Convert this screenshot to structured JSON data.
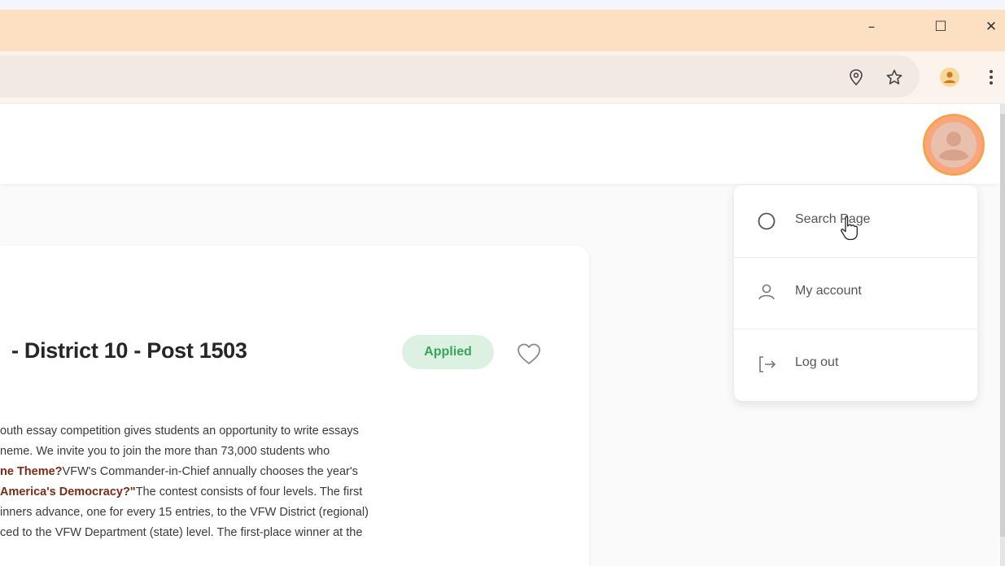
{
  "window": {
    "minimize_label": "–",
    "maximize_label": "☐",
    "close_label": "✕"
  },
  "toolbar": {
    "icons": [
      "location-pin-icon",
      "bookmark-star-icon",
      "profile-icon",
      "kebab-menu-icon"
    ]
  },
  "header": {
    "avatar_icon": "user-avatar-icon"
  },
  "card": {
    "title": "- District 10 - Post 1503",
    "status_badge": "Applied",
    "favorite_icon": "heart-icon",
    "description_lines": [
      {
        "segments": [
          {
            "text": "outh essay competition gives students an opportunity to write essays",
            "bold": false
          }
        ]
      },
      {
        "segments": [
          {
            "text": "neme. We invite you to join the more than 73,000 students who",
            "bold": false
          }
        ]
      },
      {
        "segments": [
          {
            "text": "ne Theme?",
            "bold": true
          },
          {
            "text": "VFW's Commander-in-Chief annually chooses the year's",
            "bold": false
          }
        ]
      },
      {
        "segments": [
          {
            "text": "America's Democracy?\"",
            "bold": true
          },
          {
            "text": "The contest consists of four levels. The first",
            "bold": false
          }
        ]
      },
      {
        "segments": [
          {
            "text": "inners advance, one for every 15 entries, to the VFW District (regional)",
            "bold": false
          }
        ]
      },
      {
        "segments": [
          {
            "text": "ced to the VFW Department (state) level. The first-place winner at the",
            "bold": false
          }
        ]
      }
    ]
  },
  "menu": {
    "items": [
      {
        "label": "Search Page",
        "icon": "circle-icon"
      },
      {
        "label": "My account",
        "icon": "user-icon"
      },
      {
        "label": "Log out",
        "icon": "logout-icon"
      }
    ]
  },
  "colors": {
    "titlebar": "#fde0c2",
    "accent_orange": "#f7a24d",
    "badge_green_bg": "#dcf1e1",
    "badge_green_text": "#3aa35c",
    "bold_text": "#7a2a16"
  }
}
